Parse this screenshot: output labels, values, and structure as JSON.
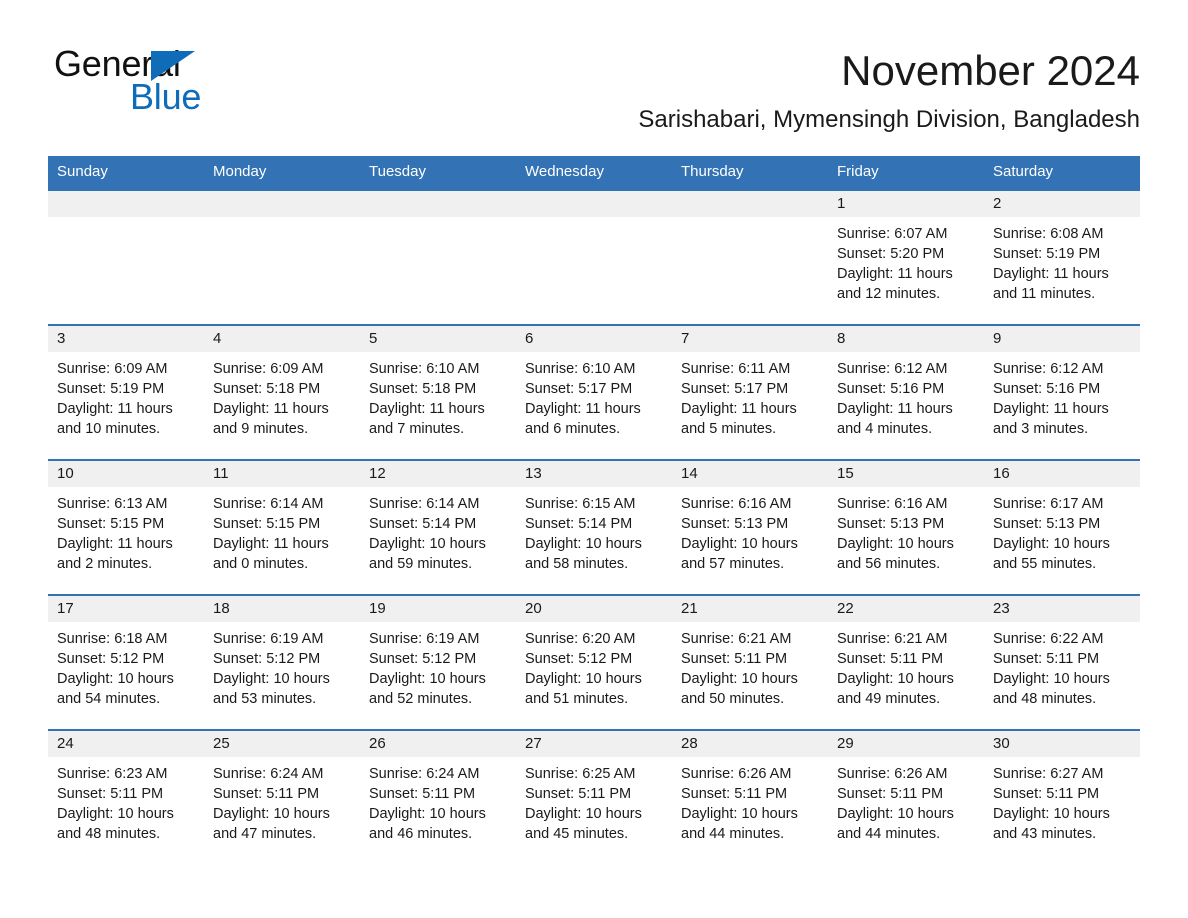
{
  "brand": {
    "name_part1": "General",
    "name_part2": "Blue",
    "flag_icon": "triangle-flag-icon",
    "accent_color": "#0f6cb8"
  },
  "header": {
    "title": "November 2024",
    "subtitle": "Sarishabari, Mymensingh Division, Bangladesh"
  },
  "calendar": {
    "header_bg_color": "#3272b5",
    "day_band_color": "#f0f0f0",
    "weekdays": [
      "Sunday",
      "Monday",
      "Tuesday",
      "Wednesday",
      "Thursday",
      "Friday",
      "Saturday"
    ],
    "weeks": [
      [
        {
          "day": "",
          "empty": true
        },
        {
          "day": "",
          "empty": true
        },
        {
          "day": "",
          "empty": true
        },
        {
          "day": "",
          "empty": true
        },
        {
          "day": "",
          "empty": true
        },
        {
          "day": "1",
          "sunrise": "Sunrise: 6:07 AM",
          "sunset": "Sunset: 5:20 PM",
          "daylight_line1": "Daylight: 11 hours",
          "daylight_line2": "and 12 minutes."
        },
        {
          "day": "2",
          "sunrise": "Sunrise: 6:08 AM",
          "sunset": "Sunset: 5:19 PM",
          "daylight_line1": "Daylight: 11 hours",
          "daylight_line2": "and 11 minutes."
        }
      ],
      [
        {
          "day": "3",
          "sunrise": "Sunrise: 6:09 AM",
          "sunset": "Sunset: 5:19 PM",
          "daylight_line1": "Daylight: 11 hours",
          "daylight_line2": "and 10 minutes."
        },
        {
          "day": "4",
          "sunrise": "Sunrise: 6:09 AM",
          "sunset": "Sunset: 5:18 PM",
          "daylight_line1": "Daylight: 11 hours",
          "daylight_line2": "and 9 minutes."
        },
        {
          "day": "5",
          "sunrise": "Sunrise: 6:10 AM",
          "sunset": "Sunset: 5:18 PM",
          "daylight_line1": "Daylight: 11 hours",
          "daylight_line2": "and 7 minutes."
        },
        {
          "day": "6",
          "sunrise": "Sunrise: 6:10 AM",
          "sunset": "Sunset: 5:17 PM",
          "daylight_line1": "Daylight: 11 hours",
          "daylight_line2": "and 6 minutes."
        },
        {
          "day": "7",
          "sunrise": "Sunrise: 6:11 AM",
          "sunset": "Sunset: 5:17 PM",
          "daylight_line1": "Daylight: 11 hours",
          "daylight_line2": "and 5 minutes."
        },
        {
          "day": "8",
          "sunrise": "Sunrise: 6:12 AM",
          "sunset": "Sunset: 5:16 PM",
          "daylight_line1": "Daylight: 11 hours",
          "daylight_line2": "and 4 minutes."
        },
        {
          "day": "9",
          "sunrise": "Sunrise: 6:12 AM",
          "sunset": "Sunset: 5:16 PM",
          "daylight_line1": "Daylight: 11 hours",
          "daylight_line2": "and 3 minutes."
        }
      ],
      [
        {
          "day": "10",
          "sunrise": "Sunrise: 6:13 AM",
          "sunset": "Sunset: 5:15 PM",
          "daylight_line1": "Daylight: 11 hours",
          "daylight_line2": "and 2 minutes."
        },
        {
          "day": "11",
          "sunrise": "Sunrise: 6:14 AM",
          "sunset": "Sunset: 5:15 PM",
          "daylight_line1": "Daylight: 11 hours",
          "daylight_line2": "and 0 minutes."
        },
        {
          "day": "12",
          "sunrise": "Sunrise: 6:14 AM",
          "sunset": "Sunset: 5:14 PM",
          "daylight_line1": "Daylight: 10 hours",
          "daylight_line2": "and 59 minutes."
        },
        {
          "day": "13",
          "sunrise": "Sunrise: 6:15 AM",
          "sunset": "Sunset: 5:14 PM",
          "daylight_line1": "Daylight: 10 hours",
          "daylight_line2": "and 58 minutes."
        },
        {
          "day": "14",
          "sunrise": "Sunrise: 6:16 AM",
          "sunset": "Sunset: 5:13 PM",
          "daylight_line1": "Daylight: 10 hours",
          "daylight_line2": "and 57 minutes."
        },
        {
          "day": "15",
          "sunrise": "Sunrise: 6:16 AM",
          "sunset": "Sunset: 5:13 PM",
          "daylight_line1": "Daylight: 10 hours",
          "daylight_line2": "and 56 minutes."
        },
        {
          "day": "16",
          "sunrise": "Sunrise: 6:17 AM",
          "sunset": "Sunset: 5:13 PM",
          "daylight_line1": "Daylight: 10 hours",
          "daylight_line2": "and 55 minutes."
        }
      ],
      [
        {
          "day": "17",
          "sunrise": "Sunrise: 6:18 AM",
          "sunset": "Sunset: 5:12 PM",
          "daylight_line1": "Daylight: 10 hours",
          "daylight_line2": "and 54 minutes."
        },
        {
          "day": "18",
          "sunrise": "Sunrise: 6:19 AM",
          "sunset": "Sunset: 5:12 PM",
          "daylight_line1": "Daylight: 10 hours",
          "daylight_line2": "and 53 minutes."
        },
        {
          "day": "19",
          "sunrise": "Sunrise: 6:19 AM",
          "sunset": "Sunset: 5:12 PM",
          "daylight_line1": "Daylight: 10 hours",
          "daylight_line2": "and 52 minutes."
        },
        {
          "day": "20",
          "sunrise": "Sunrise: 6:20 AM",
          "sunset": "Sunset: 5:12 PM",
          "daylight_line1": "Daylight: 10 hours",
          "daylight_line2": "and 51 minutes."
        },
        {
          "day": "21",
          "sunrise": "Sunrise: 6:21 AM",
          "sunset": "Sunset: 5:11 PM",
          "daylight_line1": "Daylight: 10 hours",
          "daylight_line2": "and 50 minutes."
        },
        {
          "day": "22",
          "sunrise": "Sunrise: 6:21 AM",
          "sunset": "Sunset: 5:11 PM",
          "daylight_line1": "Daylight: 10 hours",
          "daylight_line2": "and 49 minutes."
        },
        {
          "day": "23",
          "sunrise": "Sunrise: 6:22 AM",
          "sunset": "Sunset: 5:11 PM",
          "daylight_line1": "Daylight: 10 hours",
          "daylight_line2": "and 48 minutes."
        }
      ],
      [
        {
          "day": "24",
          "sunrise": "Sunrise: 6:23 AM",
          "sunset": "Sunset: 5:11 PM",
          "daylight_line1": "Daylight: 10 hours",
          "daylight_line2": "and 48 minutes."
        },
        {
          "day": "25",
          "sunrise": "Sunrise: 6:24 AM",
          "sunset": "Sunset: 5:11 PM",
          "daylight_line1": "Daylight: 10 hours",
          "daylight_line2": "and 47 minutes."
        },
        {
          "day": "26",
          "sunrise": "Sunrise: 6:24 AM",
          "sunset": "Sunset: 5:11 PM",
          "daylight_line1": "Daylight: 10 hours",
          "daylight_line2": "and 46 minutes."
        },
        {
          "day": "27",
          "sunrise": "Sunrise: 6:25 AM",
          "sunset": "Sunset: 5:11 PM",
          "daylight_line1": "Daylight: 10 hours",
          "daylight_line2": "and 45 minutes."
        },
        {
          "day": "28",
          "sunrise": "Sunrise: 6:26 AM",
          "sunset": "Sunset: 5:11 PM",
          "daylight_line1": "Daylight: 10 hours",
          "daylight_line2": "and 44 minutes."
        },
        {
          "day": "29",
          "sunrise": "Sunrise: 6:26 AM",
          "sunset": "Sunset: 5:11 PM",
          "daylight_line1": "Daylight: 10 hours",
          "daylight_line2": "and 44 minutes."
        },
        {
          "day": "30",
          "sunrise": "Sunrise: 6:27 AM",
          "sunset": "Sunset: 5:11 PM",
          "daylight_line1": "Daylight: 10 hours",
          "daylight_line2": "and 43 minutes."
        }
      ]
    ]
  }
}
